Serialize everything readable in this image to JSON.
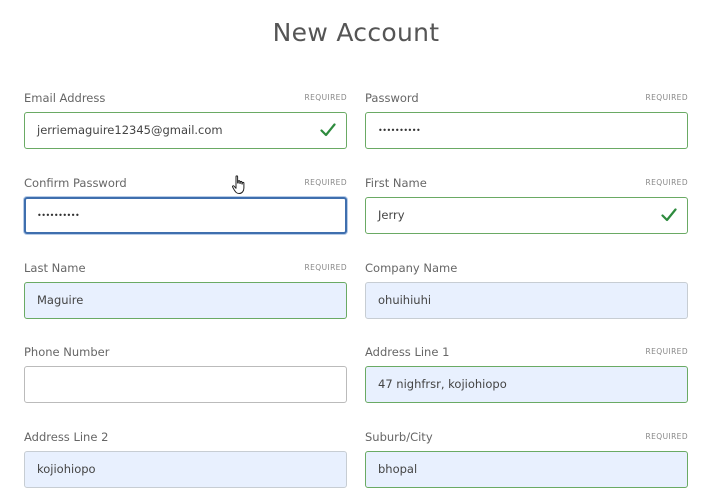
{
  "page": {
    "title": "New Account"
  },
  "required_label": "REQUIRED",
  "colors": {
    "valid_border": "#6aaa64",
    "check": "#2e8b3e",
    "focus_border": "#3f6fae",
    "autofill_bg": "#e8f0fe"
  },
  "fields": [
    {
      "label": "Email Address",
      "required": true,
      "value": "jerriemaguire12345@gmail.com",
      "state": "valid",
      "check": true
    },
    {
      "label": "Password",
      "required": true,
      "value": "••••••••••",
      "masked": true,
      "state": "valid"
    },
    {
      "label": "Confirm Password",
      "required": true,
      "value": "••••••••••",
      "masked": true,
      "state": "focused"
    },
    {
      "label": "First Name",
      "required": true,
      "value": "Jerry",
      "state": "valid",
      "check": true
    },
    {
      "label": "Last Name",
      "required": true,
      "value": "Maguire",
      "state": "autofilled-valid"
    },
    {
      "label": "Company Name",
      "required": false,
      "value": "ohuihiuhi",
      "state": "autofilled"
    },
    {
      "label": "Phone Number",
      "required": false,
      "value": "",
      "state": "empty"
    },
    {
      "label": "Address Line 1",
      "required": true,
      "value": "47 nighfrsr, kojiohiopo",
      "state": "autofilled-valid"
    },
    {
      "label": "Address Line 2",
      "required": false,
      "value": "kojiohiopo",
      "state": "autofilled"
    },
    {
      "label": "Suburb/City",
      "required": true,
      "value": "bhopal",
      "state": "autofilled-valid"
    }
  ],
  "icons": {
    "check": "checkmark-icon",
    "cursor": "hand-pointer-icon"
  }
}
